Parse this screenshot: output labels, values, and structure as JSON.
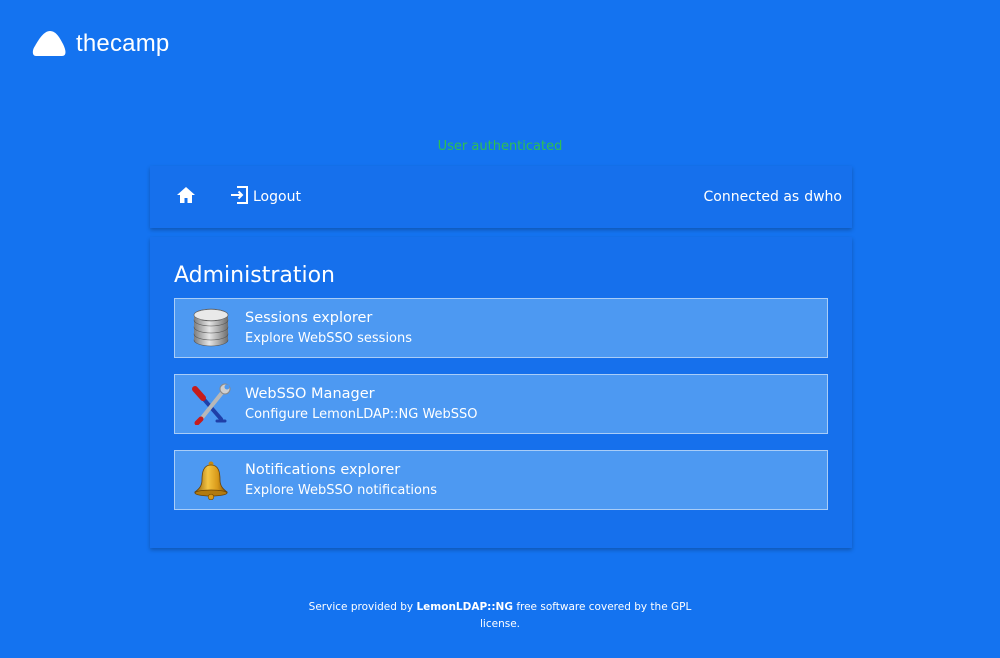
{
  "header": {
    "logo_text": "thecamp",
    "logo_icon": "cloud-blob-icon"
  },
  "status": {
    "message": "User authenticated",
    "color": "#2fbf52"
  },
  "navbar": {
    "home_icon": "home-icon",
    "logout_icon": "logout-icon",
    "logout_label": "Logout",
    "connected_prefix": "Connected as",
    "username": "dwho"
  },
  "main": {
    "title": "Administration",
    "apps": [
      {
        "name": "Sessions explorer",
        "description": "Explore WebSSO sessions",
        "icon": "database-icon"
      },
      {
        "name": "WebSSO Manager",
        "description": "Configure LemonLDAP::NG WebSSO",
        "icon": "tools-icon"
      },
      {
        "name": "Notifications explorer",
        "description": "Explore WebSSO notifications",
        "icon": "bell-icon"
      }
    ]
  },
  "footer": {
    "prefix": "Service provided by",
    "link": "LemonLDAP::NG",
    "suffix": "free software covered by the GPL license."
  },
  "colors": {
    "background": "#1473f0",
    "card": "#1670ec",
    "app_item": "#4d99f2"
  }
}
